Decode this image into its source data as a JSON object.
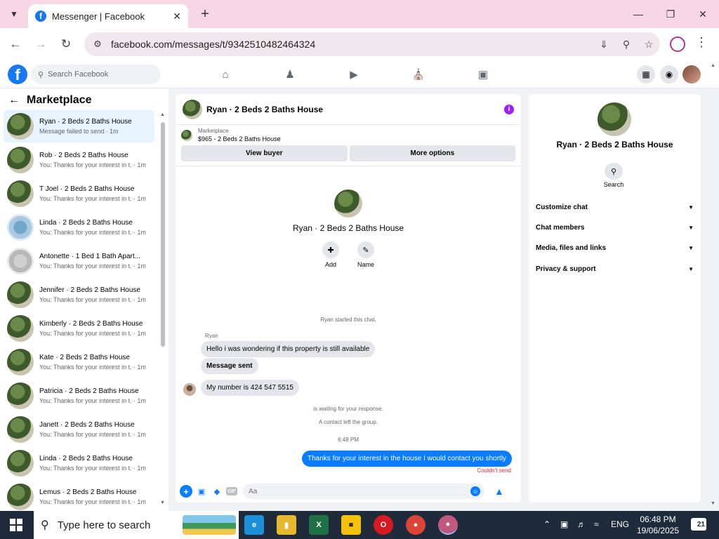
{
  "browser": {
    "tab_title": "Messenger | Facebook",
    "url": "facebook.com/messages/t/9342510482464324"
  },
  "fb": {
    "search_placeholder": "Search Facebook"
  },
  "sidebar": {
    "title": "Marketplace",
    "conversations": [
      {
        "name": "Ryan · 2 Beds 2 Baths House",
        "message": "Message failed to send",
        "time": "· 1m",
        "thumb": "house"
      },
      {
        "name": "Rob · 2 Beds 2 Baths House",
        "message": "You: Thanks for your interest in t...",
        "time": "· 1m",
        "thumb": "house"
      },
      {
        "name": "T Joel · 2 Beds 2 Baths House",
        "message": "You: Thanks for your interest in t...",
        "time": "· 1m",
        "thumb": "house"
      },
      {
        "name": "Linda · 2 Beds 2 Baths House",
        "message": "You: Thanks for your interest in t...",
        "time": "· 1m",
        "thumb": "blue-house"
      },
      {
        "name": "Antonette · 1 Bed 1 Bath Apart...",
        "message": "You: Thanks for your interest in t...",
        "time": "· 1m",
        "thumb": "interior"
      },
      {
        "name": "Jennifer · 2 Beds 2 Baths House",
        "message": "You: Thanks for your interest in t...",
        "time": "· 1m",
        "thumb": "house"
      },
      {
        "name": "Kimberly · 2 Beds 2 Baths House",
        "message": "You: Thanks for your interest in t...",
        "time": "· 1m",
        "thumb": "house"
      },
      {
        "name": "Kate · 2 Beds 2 Baths House",
        "message": "You: Thanks for your interest in t...",
        "time": "· 1m",
        "thumb": "house"
      },
      {
        "name": "Patricia · 2 Beds 2 Baths House",
        "message": "You: Thanks for your interest in t...",
        "time": "· 1m",
        "thumb": "house"
      },
      {
        "name": "Janett · 2 Beds 2 Baths House",
        "message": "You: Thanks for your interest in t...",
        "time": "· 1m",
        "thumb": "house"
      },
      {
        "name": "Linda · 2 Beds 2 Baths House",
        "message": "You: Thanks for your interest in t...",
        "time": "· 1m",
        "thumb": "house"
      },
      {
        "name": "Lemus · 2 Beds 2 Baths House",
        "message": "You: Thanks for your interest in t...",
        "time": "· 1m",
        "thumb": "house"
      }
    ]
  },
  "chat": {
    "header_name": "Ryan · 2 Beds 2 Baths House",
    "marketplace_label": "Marketplace",
    "listing": "$965 - 2 Beds 2 Baths House",
    "view_buyer": "View buyer",
    "more_options": "More options",
    "intro_name": "Ryan · 2 Beds 2 Baths House",
    "add_label": "Add",
    "name_label": "Name",
    "started": "Ryan started this chat.",
    "sender": "Ryan",
    "msg1": "Hello i was wondering if this property is still available",
    "msg2": "Message sent",
    "msg3": "My number is 424 547 5515",
    "waiting": "is waiting for your response.",
    "left_group": "A contact left the group.",
    "time": "6:48 PM",
    "my_msg": "Thanks for your interest in the house I would contact you shortly",
    "error": "Couldn't send",
    "input_placeholder": "Aa"
  },
  "info": {
    "name": "Ryan · 2 Beds 2 Baths House",
    "search_label": "Search",
    "sections": [
      "Customize chat",
      "Chat members",
      "Media, files and links",
      "Privacy & support"
    ]
  },
  "taskbar": {
    "search_placeholder": "Type here to search",
    "lang": "ENG",
    "time": "06:48 PM",
    "date": "19/06/2025",
    "notifications": "21"
  }
}
